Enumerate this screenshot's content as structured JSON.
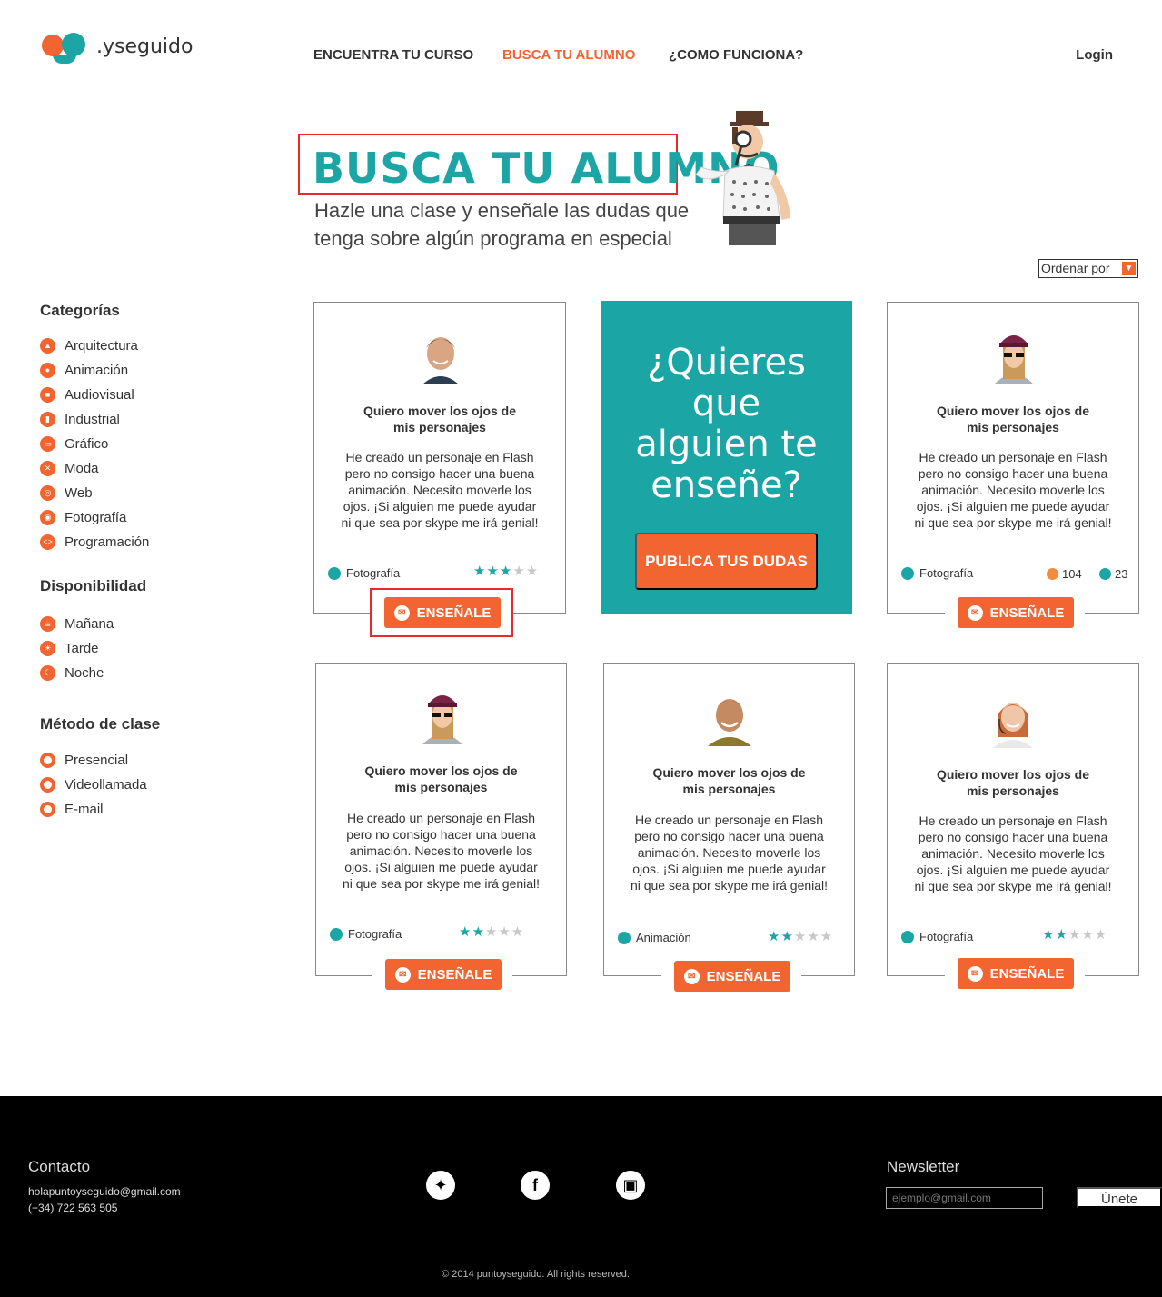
{
  "brand": {
    "name": ".yseguido"
  },
  "nav": {
    "items": [
      "ENCUENTRA TU CURSO",
      "BUSCA TU  ALUMNO",
      "¿COMO FUNCIONA?"
    ],
    "login": "Login"
  },
  "hero": {
    "title": "BUSCA TU ALUMNO",
    "subtitle_line1": "Hazle una clase y enseñale las dudas que",
    "subtitle_line2": "tenga sobre algún programa en especial"
  },
  "sort": {
    "label": "Ordenar por"
  },
  "sidebar": {
    "categories_title": "Categorías",
    "categories": [
      "Arquitectura",
      "Animación",
      "Audiovisual",
      "Industrial",
      "Gráfico",
      "Moda",
      "Web",
      "Fotografía",
      "Programación"
    ],
    "availability_title": "Disponibilidad",
    "availability": [
      "Mañana",
      "Tarde",
      "Noche"
    ],
    "method_title": "Método de clase",
    "methods": [
      "Presencial",
      "Videollamada",
      "E-mail"
    ]
  },
  "cards": [
    {
      "title_1": "Quiero mover los ojos de",
      "title_2": "mis personajes",
      "body_1": "He creado un personaje en Flash",
      "body_2": "pero no consigo hacer una buena",
      "body_3": "animación. Necesito moverle los",
      "body_4": "ojos. ¡Si alguien me puede ayudar",
      "body_5": "ni que sea por skype me irá genial!",
      "category": "Fotografía",
      "rating": 3,
      "button": "ENSEÑALE"
    },
    {
      "title_1": "Quiero mover los ojos de",
      "title_2": "mis personajes",
      "body_1": "He creado un personaje en Flash",
      "body_2": "pero no consigo hacer una buena",
      "body_3": "animación. Necesito moverle los",
      "body_4": "ojos. ¡Si alguien me puede ayudar",
      "body_5": "ni que sea por skype me irá genial!",
      "category": "Fotografía",
      "likes": "104",
      "comments": "23",
      "button": "ENSEÑALE"
    },
    {
      "title_1": "Quiero mover los ojos de",
      "title_2": "mis personajes",
      "body_1": "He creado un personaje en Flash",
      "body_2": "pero no consigo hacer una buena",
      "body_3": "animación. Necesito moverle los",
      "body_4": "ojos. ¡Si alguien me puede ayudar",
      "body_5": "ni que sea por skype me irá genial!",
      "category": "Fotografía",
      "rating": 2,
      "button": "ENSEÑALE"
    },
    {
      "title_1": "Quiero mover los ojos de",
      "title_2": "mis personajes",
      "body_1": "He creado un personaje en Flash",
      "body_2": "pero no consigo hacer una buena",
      "body_3": "animación. Necesito moverle los",
      "body_4": "ojos. ¡Si alguien me puede ayudar",
      "body_5": "ni que sea por skype me irá genial!",
      "category": "Animación",
      "rating": 2,
      "button": "ENSEÑALE"
    },
    {
      "title_1": "Quiero mover los ojos de",
      "title_2": "mis personajes",
      "body_1": "He creado un personaje en Flash",
      "body_2": "pero no consigo hacer una buena",
      "body_3": "animación. Necesito moverle los",
      "body_4": "ojos. ¡Si alguien me puede ayudar",
      "body_5": "ni que sea por skype me irá genial!",
      "category": "Fotografía",
      "rating": 2,
      "button": "ENSEÑALE"
    }
  ],
  "promo": {
    "line1": "¿Quieres",
    "line2": "que",
    "line3": "alguien te",
    "line4": "enseñe?",
    "button": "PUBLICA TUS DUDAS"
  },
  "footer": {
    "contact_title": "Contacto",
    "email": "holapuntoyseguido@gmail.com",
    "phone": "(+34) 722 563 505",
    "newsletter_title": "Newsletter",
    "newsletter_placeholder": "ejemplo@gmail.com",
    "newsletter_button": "Únete",
    "copyright": "© 2014 puntoyseguido. All rights reserved."
  },
  "colors": {
    "accent": "#f26430",
    "teal": "#1ba6a5",
    "highlight": "#e52b2b"
  }
}
